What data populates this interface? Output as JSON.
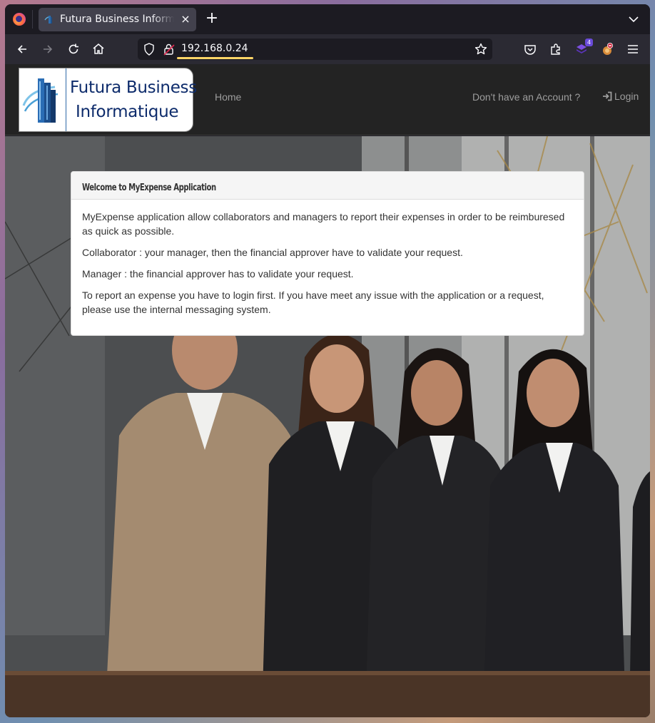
{
  "browser": {
    "tab_title": "Futura Business Informatique",
    "url": "192.168.0.24",
    "extension_badge_count": "4"
  },
  "site": {
    "logo_line1": "Futura Business",
    "logo_line2": "Informatique",
    "nav_home": "Home",
    "nav_account": "Don't have an Account ?",
    "nav_login": "Login"
  },
  "welcome_panel": {
    "title": "Welcome to MyExpense Application",
    "paragraphs": [
      "MyExpense application allow collaborators and managers to report their expenses in order to be reimburesed as quick as possible.",
      "Collaborator : your manager, then the financial approver have to validate your request.",
      "Manager : the financial approver has to validate your request.",
      "To report an expense you have to login first. If you have meet any issue with the application or a request, please use the internal messaging system."
    ]
  }
}
